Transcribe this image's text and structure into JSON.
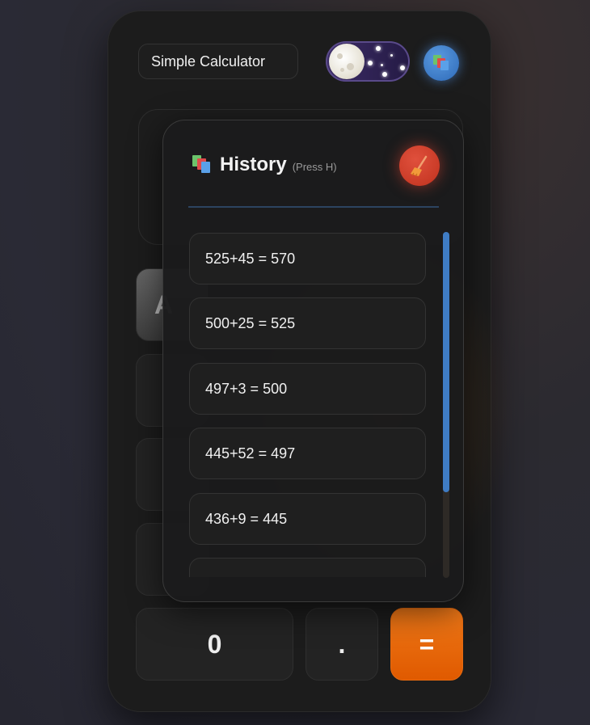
{
  "header": {
    "title": "Simple Calculator"
  },
  "theme_toggle": {
    "state": "dark",
    "icon": "moon-icon"
  },
  "history_button": {
    "icon": "books-icon"
  },
  "keypad": {
    "partial_key": "A",
    "zero": "0",
    "dot": ".",
    "equals": "="
  },
  "history": {
    "icon": "books-icon",
    "title": "History",
    "hint": "(Press H)",
    "clear_icon": "broom-icon",
    "items": [
      "525+45 = 570",
      "500+25 = 525",
      "497+3 = 500",
      "445+52 = 497",
      "436+9 = 445"
    ]
  },
  "colors": {
    "accent_blue": "#3f7cc4",
    "equals_orange": "#e66a10",
    "clear_red": "#d0402a"
  }
}
